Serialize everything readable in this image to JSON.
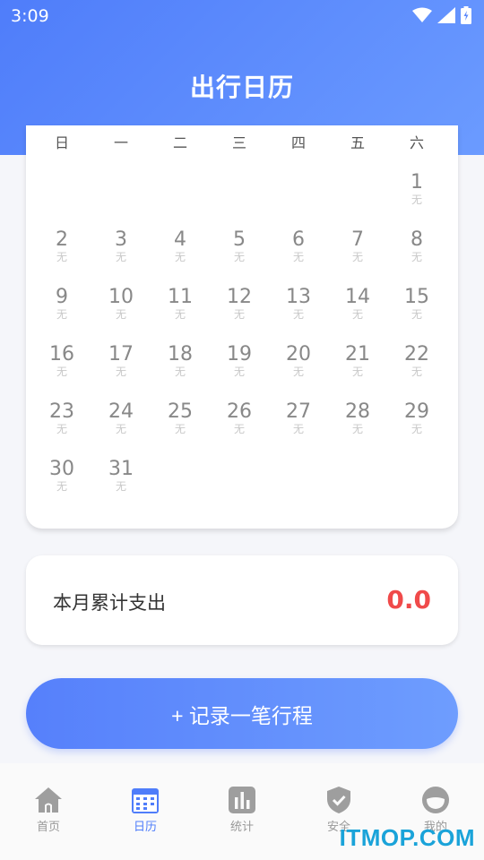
{
  "status_bar": {
    "time": "3:09"
  },
  "header": {
    "title": "出行日历"
  },
  "calendar": {
    "weekdays": [
      "日",
      "一",
      "二",
      "三",
      "四",
      "五",
      "六"
    ],
    "first_weekday_index": 6,
    "days": [
      {
        "num": "1",
        "sub": "无"
      },
      {
        "num": "2",
        "sub": "无"
      },
      {
        "num": "3",
        "sub": "无"
      },
      {
        "num": "4",
        "sub": "无"
      },
      {
        "num": "5",
        "sub": "无"
      },
      {
        "num": "6",
        "sub": "无"
      },
      {
        "num": "7",
        "sub": "无"
      },
      {
        "num": "8",
        "sub": "无"
      },
      {
        "num": "9",
        "sub": "无"
      },
      {
        "num": "10",
        "sub": "无"
      },
      {
        "num": "11",
        "sub": "无"
      },
      {
        "num": "12",
        "sub": "无"
      },
      {
        "num": "13",
        "sub": "无"
      },
      {
        "num": "14",
        "sub": "无"
      },
      {
        "num": "15",
        "sub": "无"
      },
      {
        "num": "16",
        "sub": "无"
      },
      {
        "num": "17",
        "sub": "无"
      },
      {
        "num": "18",
        "sub": "无"
      },
      {
        "num": "19",
        "sub": "无"
      },
      {
        "num": "20",
        "sub": "无"
      },
      {
        "num": "21",
        "sub": "无"
      },
      {
        "num": "22",
        "sub": "无"
      },
      {
        "num": "23",
        "sub": "无"
      },
      {
        "num": "24",
        "sub": "无"
      },
      {
        "num": "25",
        "sub": "无"
      },
      {
        "num": "26",
        "sub": "无"
      },
      {
        "num": "27",
        "sub": "无"
      },
      {
        "num": "28",
        "sub": "无"
      },
      {
        "num": "29",
        "sub": "无"
      },
      {
        "num": "30",
        "sub": "无"
      },
      {
        "num": "31",
        "sub": "无"
      }
    ]
  },
  "expense": {
    "label": "本月累计支出",
    "value": "0.0",
    "value_color": "#f04a4a"
  },
  "record_button": {
    "label": "+ 记录一笔行程"
  },
  "tabbar": {
    "items": [
      {
        "label": "首页",
        "icon": "home-icon"
      },
      {
        "label": "日历",
        "icon": "calendar-icon",
        "active": true
      },
      {
        "label": "统计",
        "icon": "bar-chart-icon"
      },
      {
        "label": "安全",
        "icon": "shield-check-icon"
      },
      {
        "label": "我的",
        "icon": "profile-icon"
      }
    ]
  },
  "watermark": {
    "text": "ITMOP.COM"
  },
  "colors": {
    "accent": "#4f7dfa",
    "header_gradient_end": "#6b9bff"
  }
}
